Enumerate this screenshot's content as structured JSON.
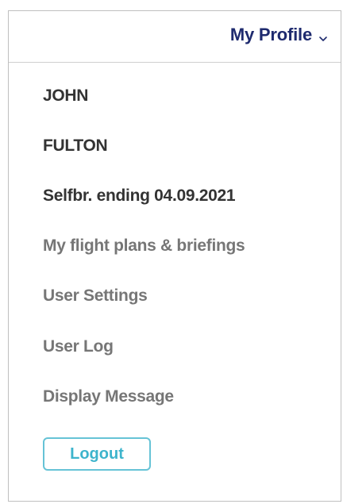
{
  "header": {
    "profile_label": "My Profile",
    "chevron_icon": "chevron-down-icon"
  },
  "menu": {
    "first_name": "JOHN",
    "last_name": "FULTON",
    "subscription": "Selfbr. ending 04.09.2021",
    "items": [
      {
        "label": "My flight plans & briefings"
      },
      {
        "label": "User Settings"
      },
      {
        "label": "User Log"
      },
      {
        "label": "Display Message"
      }
    ],
    "logout_label": "Logout"
  },
  "colors": {
    "profile_label": "#1e2a6e",
    "dark_text": "#333333",
    "muted_text": "#767676",
    "logout_accent": "#3db4cc"
  }
}
